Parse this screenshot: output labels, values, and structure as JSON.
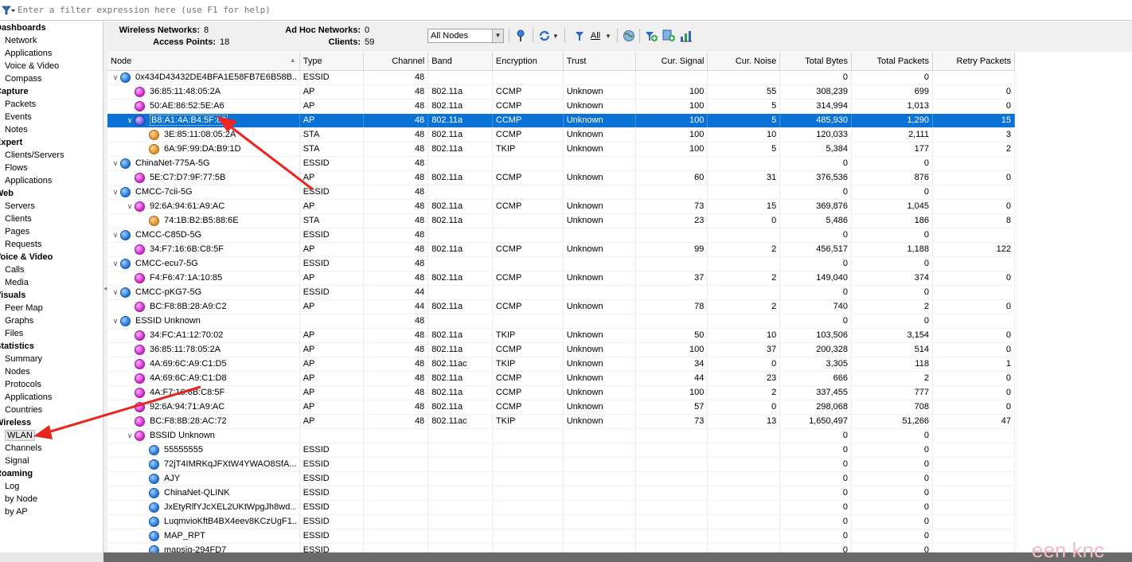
{
  "filter": {
    "placeholder": "Enter a filter expression here (use F1 for help)",
    "icon": "filter-funnel-icon"
  },
  "sidebar": {
    "sections": [
      {
        "title": "Dashboards",
        "items": [
          "Network",
          "Applications",
          "Voice & Video",
          "Compass"
        ]
      },
      {
        "title": "Capture",
        "items": [
          "Packets",
          "Events",
          "Notes"
        ]
      },
      {
        "title": "Expert",
        "items": [
          "Clients/Servers",
          "Flows",
          "Applications"
        ]
      },
      {
        "title": "Web",
        "items": [
          "Servers",
          "Clients",
          "Pages",
          "Requests"
        ]
      },
      {
        "title": "Voice & Video",
        "items": [
          "Calls",
          "Media"
        ]
      },
      {
        "title": "Visuals",
        "items": [
          "Peer Map",
          "Graphs",
          "Files"
        ]
      },
      {
        "title": "Statistics",
        "items": [
          "Summary",
          "Nodes",
          "Protocols",
          "Applications",
          "Countries"
        ]
      },
      {
        "title": "Wireless",
        "items": [
          "WLAN",
          "Channels",
          "Signal"
        ]
      },
      {
        "title": "Roaming",
        "items": [
          "Log",
          "by Node",
          "by AP"
        ]
      }
    ],
    "selected": "WLAN"
  },
  "stats": {
    "wireless_networks_label": "Wireless Networks:",
    "wireless_networks": "8",
    "access_points_label": "Access Points:",
    "access_points": "18",
    "adhoc_label": "Ad Hoc Networks:",
    "adhoc": "0",
    "clients_label": "Clients:",
    "clients": "59"
  },
  "toolbar": {
    "node_select": "All Nodes",
    "filter_all_label": "All",
    "icons": [
      "probe-icon",
      "refresh-icon",
      "filter-icon",
      "globe-icon",
      "add-filter-icon",
      "add-node-icon",
      "chart-icon"
    ]
  },
  "table": {
    "columns": [
      "Node",
      "Type",
      "Channel",
      "Band",
      "Encryption",
      "Trust",
      "Cur. Signal",
      "Cur. Noise",
      "Total Bytes",
      "Total Packets",
      "Retry Packets"
    ],
    "rows": [
      {
        "level": 0,
        "chev": "v",
        "icon": "ssid",
        "node": "0x434D43432DE4BFA1E58FB7E6B58B...",
        "type": "ESSID",
        "channel": "48",
        "band": "",
        "enc": "",
        "trust": "",
        "signal": "",
        "noise": "",
        "bytes": "0",
        "packets": "0",
        "retry": ""
      },
      {
        "level": 1,
        "chev": "",
        "icon": "ap",
        "node": "36:85:11:48:05:2A",
        "type": "AP",
        "channel": "48",
        "band": "802.11a",
        "enc": "CCMP",
        "trust": "Unknown",
        "signal": "100",
        "noise": "55",
        "bytes": "308,239",
        "packets": "699",
        "retry": "0"
      },
      {
        "level": 1,
        "chev": "",
        "icon": "ap",
        "node": "50:AE:86:52:5E:A6",
        "type": "AP",
        "channel": "48",
        "band": "802.11a",
        "enc": "CCMP",
        "trust": "Unknown",
        "signal": "100",
        "noise": "5",
        "bytes": "314,994",
        "packets": "1,013",
        "retry": "0"
      },
      {
        "level": 1,
        "chev": "v",
        "icon": "apsel",
        "node": "B8:A1:4A:B4:5F:82",
        "type": "AP",
        "channel": "48",
        "band": "802.11a",
        "enc": "CCMP",
        "trust": "Unknown",
        "signal": "100",
        "noise": "5",
        "bytes": "485,930",
        "packets": "1,290",
        "retry": "15",
        "selected": true
      },
      {
        "level": 2,
        "chev": "",
        "icon": "sta",
        "node": "3E:85:11:08:05:2A",
        "type": "STA",
        "channel": "48",
        "band": "802.11a",
        "enc": "CCMP",
        "trust": "Unknown",
        "signal": "100",
        "noise": "10",
        "bytes": "120,033",
        "packets": "2,111",
        "retry": "3"
      },
      {
        "level": 2,
        "chev": "",
        "icon": "sta",
        "node": "6A:9F:99:DA:B9:1D",
        "type": "STA",
        "channel": "48",
        "band": "802.11a",
        "enc": "TKIP",
        "trust": "Unknown",
        "signal": "100",
        "noise": "5",
        "bytes": "5,384",
        "packets": "177",
        "retry": "2"
      },
      {
        "level": 0,
        "chev": "v",
        "icon": "ssid",
        "node": "ChinaNet-775A-5G",
        "type": "ESSID",
        "channel": "48",
        "band": "",
        "enc": "",
        "trust": "",
        "signal": "",
        "noise": "",
        "bytes": "0",
        "packets": "0",
        "retry": ""
      },
      {
        "level": 1,
        "chev": "",
        "icon": "ap",
        "node": "5E:C7:D7:9F:77:5B",
        "type": "AP",
        "channel": "48",
        "band": "802.11a",
        "enc": "CCMP",
        "trust": "Unknown",
        "signal": "60",
        "noise": "31",
        "bytes": "376,536",
        "packets": "876",
        "retry": "0"
      },
      {
        "level": 0,
        "chev": "v",
        "icon": "ssid",
        "node": "CMCC-7cii-5G",
        "type": "ESSID",
        "channel": "48",
        "band": "",
        "enc": "",
        "trust": "",
        "signal": "",
        "noise": "",
        "bytes": "0",
        "packets": "0",
        "retry": ""
      },
      {
        "level": 1,
        "chev": "v",
        "icon": "ap",
        "node": "92:6A:94:61:A9:AC",
        "type": "AP",
        "channel": "48",
        "band": "802.11a",
        "enc": "CCMP",
        "trust": "Unknown",
        "signal": "73",
        "noise": "15",
        "bytes": "369,876",
        "packets": "1,045",
        "retry": "0"
      },
      {
        "level": 2,
        "chev": "",
        "icon": "sta",
        "node": "74:1B:B2:B5:88:6E",
        "type": "STA",
        "channel": "48",
        "band": "802.11a",
        "enc": "",
        "trust": "Unknown",
        "signal": "23",
        "noise": "0",
        "bytes": "5,486",
        "packets": "186",
        "retry": "8"
      },
      {
        "level": 0,
        "chev": "v",
        "icon": "ssid",
        "node": "CMCC-C85D-5G",
        "type": "ESSID",
        "channel": "48",
        "band": "",
        "enc": "",
        "trust": "",
        "signal": "",
        "noise": "",
        "bytes": "0",
        "packets": "0",
        "retry": ""
      },
      {
        "level": 1,
        "chev": "",
        "icon": "ap",
        "node": "34:F7:16:6B:C8:5F",
        "type": "AP",
        "channel": "48",
        "band": "802.11a",
        "enc": "CCMP",
        "trust": "Unknown",
        "signal": "99",
        "noise": "2",
        "bytes": "456,517",
        "packets": "1,188",
        "retry": "122"
      },
      {
        "level": 0,
        "chev": "v",
        "icon": "ssid",
        "node": "CMCC-ecu7-5G",
        "type": "ESSID",
        "channel": "48",
        "band": "",
        "enc": "",
        "trust": "",
        "signal": "",
        "noise": "",
        "bytes": "0",
        "packets": "0",
        "retry": ""
      },
      {
        "level": 1,
        "chev": "",
        "icon": "ap",
        "node": "F4:F6:47:1A:10:85",
        "type": "AP",
        "channel": "48",
        "band": "802.11a",
        "enc": "CCMP",
        "trust": "Unknown",
        "signal": "37",
        "noise": "2",
        "bytes": "149,040",
        "packets": "374",
        "retry": "0"
      },
      {
        "level": 0,
        "chev": "v",
        "icon": "ssid",
        "node": "CMCC-pKG7-5G",
        "type": "ESSID",
        "channel": "44",
        "band": "",
        "enc": "",
        "trust": "",
        "signal": "",
        "noise": "",
        "bytes": "0",
        "packets": "0",
        "retry": ""
      },
      {
        "level": 1,
        "chev": "",
        "icon": "ap",
        "node": "BC:F8:8B:28:A9:C2",
        "type": "AP",
        "channel": "44",
        "band": "802.11a",
        "enc": "CCMP",
        "trust": "Unknown",
        "signal": "78",
        "noise": "2",
        "bytes": "740",
        "packets": "2",
        "retry": "0"
      },
      {
        "level": 0,
        "chev": "v",
        "icon": "ssid",
        "node": "ESSID Unknown",
        "type": "",
        "channel": "48",
        "band": "",
        "enc": "",
        "trust": "",
        "signal": "",
        "noise": "",
        "bytes": "0",
        "packets": "0",
        "retry": ""
      },
      {
        "level": 1,
        "chev": "",
        "icon": "ap",
        "node": "34:FC:A1:12:70:02",
        "type": "AP",
        "channel": "48",
        "band": "802.11a",
        "enc": "TKIP",
        "trust": "Unknown",
        "signal": "50",
        "noise": "10",
        "bytes": "103,506",
        "packets": "3,154",
        "retry": "0"
      },
      {
        "level": 1,
        "chev": "",
        "icon": "ap",
        "node": "36:85:11:78:05:2A",
        "type": "AP",
        "channel": "48",
        "band": "802.11a",
        "enc": "CCMP",
        "trust": "Unknown",
        "signal": "100",
        "noise": "37",
        "bytes": "200,328",
        "packets": "514",
        "retry": "0"
      },
      {
        "level": 1,
        "chev": "",
        "icon": "ap",
        "node": "4A:69:6C:A9:C1:D5",
        "type": "AP",
        "channel": "48",
        "band": "802.11ac",
        "enc": "TKIP",
        "trust": "Unknown",
        "signal": "34",
        "noise": "0",
        "bytes": "3,305",
        "packets": "118",
        "retry": "1"
      },
      {
        "level": 1,
        "chev": "",
        "icon": "ap",
        "node": "4A:69:6C:A9:C1:D8",
        "type": "AP",
        "channel": "48",
        "band": "802.11a",
        "enc": "CCMP",
        "trust": "Unknown",
        "signal": "44",
        "noise": "23",
        "bytes": "666",
        "packets": "2",
        "retry": "0"
      },
      {
        "level": 1,
        "chev": "",
        "icon": "ap",
        "node": "4A:F7:16:6B:C8:5F",
        "type": "AP",
        "channel": "48",
        "band": "802.11a",
        "enc": "CCMP",
        "trust": "Unknown",
        "signal": "100",
        "noise": "2",
        "bytes": "337,455",
        "packets": "777",
        "retry": "0"
      },
      {
        "level": 1,
        "chev": "",
        "icon": "ap",
        "node": "92:6A:94:71:A9:AC",
        "type": "AP",
        "channel": "48",
        "band": "802.11a",
        "enc": "CCMP",
        "trust": "Unknown",
        "signal": "57",
        "noise": "0",
        "bytes": "298,068",
        "packets": "708",
        "retry": "0"
      },
      {
        "level": 1,
        "chev": "",
        "icon": "ap",
        "node": "BC:F8:8B:28:AC:72",
        "type": "AP",
        "channel": "48",
        "band": "802.11ac",
        "enc": "TKIP",
        "trust": "Unknown",
        "signal": "73",
        "noise": "13",
        "bytes": "1,650,497",
        "packets": "51,266",
        "retry": "47"
      },
      {
        "level": 1,
        "chev": "v",
        "icon": "ap",
        "node": "BSSID Unknown",
        "type": "",
        "channel": "",
        "band": "",
        "enc": "",
        "trust": "",
        "signal": "",
        "noise": "",
        "bytes": "0",
        "packets": "0",
        "retry": ""
      },
      {
        "level": 2,
        "chev": "",
        "icon": "ssid",
        "node": "55555555",
        "type": "ESSID",
        "channel": "",
        "band": "",
        "enc": "",
        "trust": "",
        "signal": "",
        "noise": "",
        "bytes": "0",
        "packets": "0",
        "retry": ""
      },
      {
        "level": 2,
        "chev": "",
        "icon": "ssid",
        "node": "72jT4IMRKqJFXtW4YWAO8SfA...",
        "type": "ESSID",
        "channel": "",
        "band": "",
        "enc": "",
        "trust": "",
        "signal": "",
        "noise": "",
        "bytes": "0",
        "packets": "0",
        "retry": ""
      },
      {
        "level": 2,
        "chev": "",
        "icon": "ssid",
        "node": "AJY",
        "type": "ESSID",
        "channel": "",
        "band": "",
        "enc": "",
        "trust": "",
        "signal": "",
        "noise": "",
        "bytes": "0",
        "packets": "0",
        "retry": ""
      },
      {
        "level": 2,
        "chev": "",
        "icon": "ssid",
        "node": "ChinaNet-QLINK",
        "type": "ESSID",
        "channel": "",
        "band": "",
        "enc": "",
        "trust": "",
        "signal": "",
        "noise": "",
        "bytes": "0",
        "packets": "0",
        "retry": ""
      },
      {
        "level": 2,
        "chev": "",
        "icon": "ssid",
        "node": "JxEtyRlfYJcXEL2UKtWpgJh8wd...",
        "type": "ESSID",
        "channel": "",
        "band": "",
        "enc": "",
        "trust": "",
        "signal": "",
        "noise": "",
        "bytes": "0",
        "packets": "0",
        "retry": ""
      },
      {
        "level": 2,
        "chev": "",
        "icon": "ssid",
        "node": "LuqmvioKftB4BX4eev8KCzUgF1...",
        "type": "ESSID",
        "channel": "",
        "band": "",
        "enc": "",
        "trust": "",
        "signal": "",
        "noise": "",
        "bytes": "0",
        "packets": "0",
        "retry": ""
      },
      {
        "level": 2,
        "chev": "",
        "icon": "ssid",
        "node": "MAP_RPT",
        "type": "ESSID",
        "channel": "",
        "band": "",
        "enc": "",
        "trust": "",
        "signal": "",
        "noise": "",
        "bytes": "0",
        "packets": "0",
        "retry": ""
      },
      {
        "level": 2,
        "chev": "",
        "icon": "ssid",
        "node": "mapsig-294FD7",
        "type": "ESSID",
        "channel": "",
        "band": "",
        "enc": "",
        "trust": "",
        "signal": "",
        "noise": "",
        "bytes": "0",
        "packets": "0",
        "retry": ""
      }
    ]
  },
  "watermark": "een knc",
  "colors": {
    "selection": "#0a72d6",
    "annotation_arrow": "#e8251f"
  }
}
